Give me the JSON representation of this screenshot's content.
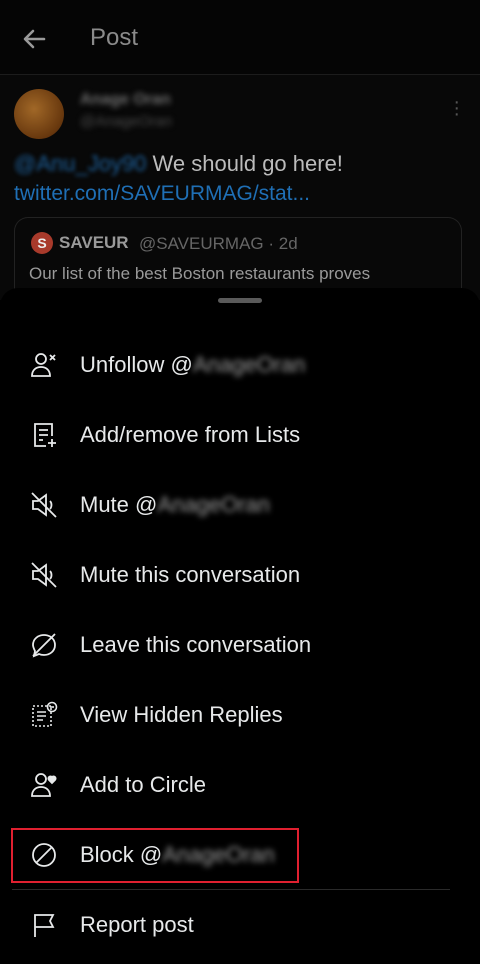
{
  "header": {
    "title": "Post"
  },
  "tweet": {
    "author_name": "Anage Oran",
    "author_handle": "@AnageOran",
    "mention": "@Anu_Joy90",
    "text": " We should go here!",
    "link": "twitter.com/SAVEURMAG/stat...",
    "quote": {
      "logo_letter": "S",
      "name": "SAVEUR",
      "handle": "@SAVEURMAG · 2d",
      "text": "Our list of the best Boston restaurants proves"
    }
  },
  "menu": {
    "items": [
      {
        "label": "Unfollow @",
        "blurred": "AnageOran",
        "icon": "person-x-icon"
      },
      {
        "label": "Add/remove from Lists",
        "icon": "list-add-icon"
      },
      {
        "label": "Mute @",
        "blurred": "AnageOran",
        "icon": "mute-icon"
      },
      {
        "label": "Mute this conversation",
        "icon": "mute-conversation-icon"
      },
      {
        "label": "Leave this conversation",
        "icon": "leave-bubble-icon"
      },
      {
        "label": "View Hidden Replies",
        "icon": "hidden-replies-icon"
      },
      {
        "label": "Add to Circle",
        "icon": "person-heart-icon"
      },
      {
        "label": "Block @",
        "blurred": "AnageOran",
        "icon": "block-icon"
      },
      {
        "label": "Report post",
        "icon": "flag-icon"
      }
    ]
  },
  "colors": {
    "highlight": "#e02030",
    "link": "#1f6fb5",
    "background": "#000000"
  }
}
